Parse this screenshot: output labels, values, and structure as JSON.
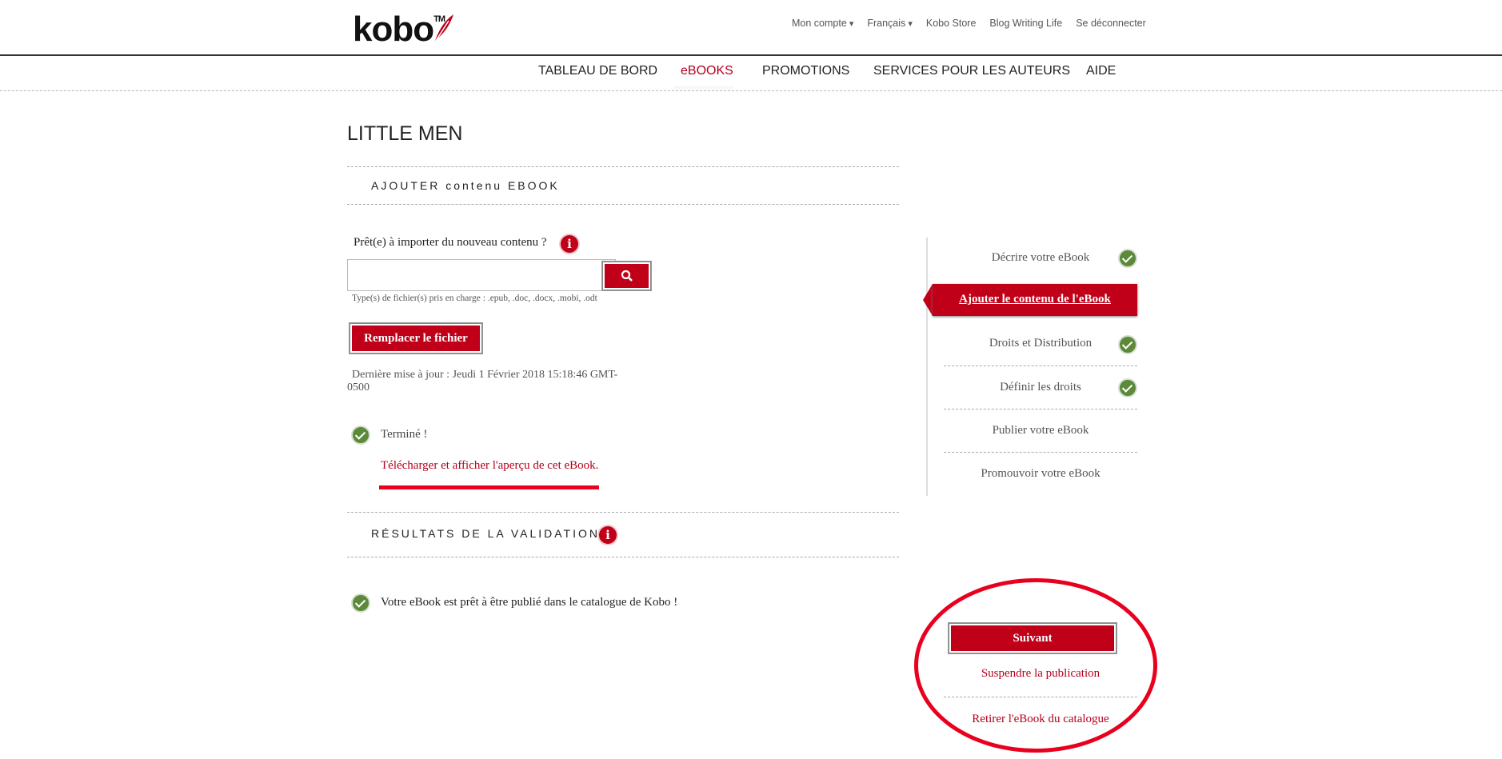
{
  "header": {
    "logo_text": "kobo",
    "logo_tm": "TM",
    "top_links": [
      "Mon compte",
      "Français",
      "Kobo Store",
      "Blog Writing Life",
      "Se déconnecter"
    ]
  },
  "main_nav": [
    {
      "label": "TABLEAU DE BORD",
      "active": false
    },
    {
      "label": "eBOOKS",
      "active": true
    },
    {
      "label": "PROMOTIONS",
      "active": false
    },
    {
      "label": "SERVICES POUR LES AUTEURS",
      "active": false
    },
    {
      "label": "AIDE",
      "active": false
    }
  ],
  "page_title": "LITTLE MEN",
  "add_content": {
    "section_title": "AJOUTER contenu EBOOK",
    "import_prompt": "Prêt(e) à importer du nouveau contenu ?",
    "file_input_value": "",
    "file_types": "Type(s) de fichier(s) pris en charge : .epub, .doc, .docx, .mobi, .odt",
    "replace_button": "Remplacer le fichier",
    "last_update_line1": "Dernière mise à jour : Jeudi 1 Février 2018 15:18:46 GMT-",
    "last_update_line2": "0500",
    "done_label": "Terminé !",
    "download_preview_link": "Télécharger et afficher l'aperçu de cet eBook."
  },
  "validation": {
    "section_title": "RÉSULTATS DE LA VALIDATION",
    "message": "Votre eBook est prêt à être publié dans le catalogue de Kobo !"
  },
  "steps": [
    {
      "label": "Décrire votre eBook",
      "done": true
    },
    {
      "label": "Ajouter le contenu de l'eBook",
      "active": true
    },
    {
      "label": "Droits et Distribution",
      "done": true
    },
    {
      "label": "Définir les droits",
      "done": true
    },
    {
      "label": "Publier votre eBook",
      "done": false
    },
    {
      "label": "Promouvoir votre eBook",
      "done": false
    }
  ],
  "actions": {
    "next_button": "Suivant",
    "suspend_link": "Suspendre la publication",
    "withdraw_link": "Retirer l'eBook du catalogue"
  },
  "colors": {
    "accent": "#c00018",
    "check": "#5c8a3a",
    "annotation": "#e8001e"
  }
}
